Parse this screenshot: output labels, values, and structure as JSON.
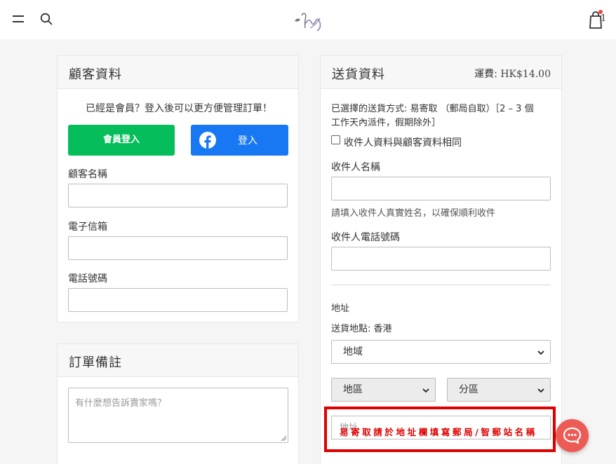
{
  "header": {
    "cart_count": "1"
  },
  "customer": {
    "title": "顧客資料",
    "login_prompt": "已經是會員？登入後可以更方便管理訂單！",
    "member_login": "會員登入",
    "fb_login": "登入",
    "name_label": "顧客名稱",
    "email_label": "電子信箱",
    "phone_label": "電話號碼"
  },
  "remarks": {
    "title": "訂單備註",
    "placeholder": "有什麼想告訴賣家嗎？"
  },
  "shipping": {
    "title": "送貨資料",
    "fee_label": "運費:",
    "fee_value": "HK$14.00",
    "method_line1": "已選擇的送貨方式: 易寄取 （郵局自取）［2 – 3 個",
    "method_line2": "工作天內派件，假期除外］",
    "same_as_customer": "收件人資料與顧客資料相同",
    "recipient_name_label": "收件人名稱",
    "recipient_name_hint": "請填入收件人真實姓名，以確保順利收件",
    "recipient_phone_label": "收件人電話號碼",
    "address_label": "地址",
    "location_text": "送貨地點: 香港",
    "region_select": "地域",
    "district_select": "地區",
    "subdistrict_select": "分區",
    "address_placeholder": "地址",
    "address_warning": "易寄取請於地址欄填寫郵局/智郵站名稱"
  },
  "colors": {
    "member_btn": "#06bd5b",
    "fb_btn": "#1877f2",
    "warning_red": "#e00000",
    "chat_bubble": "#ee5b55"
  },
  "icons": [
    "menu-icon",
    "search-icon",
    "logo",
    "cart-icon",
    "facebook-icon",
    "chevron-down-icon",
    "chat-icon"
  ]
}
